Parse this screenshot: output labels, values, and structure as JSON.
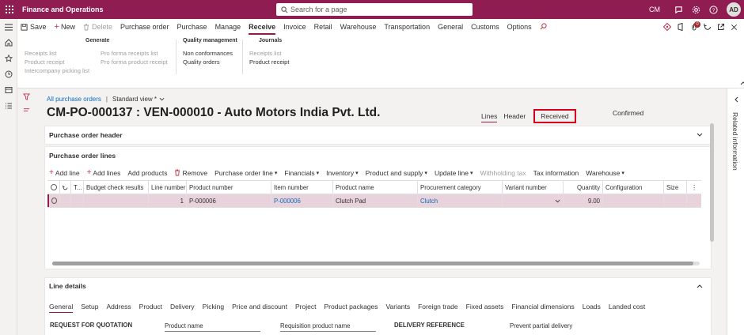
{
  "top_bar": {
    "app_title": "Finance and Operations",
    "search_placeholder": "Search for a page",
    "company": "CM",
    "avatar_initials": "AD",
    "brand_color": "#8f1d52"
  },
  "action_pane": {
    "commands": {
      "save": "Save",
      "new": "New",
      "delete": "Delete"
    },
    "tabs": [
      "Purchase order",
      "Purchase",
      "Manage",
      "Receive",
      "Invoice",
      "Retail",
      "Warehouse",
      "Transportation",
      "General",
      "Customs",
      "Options"
    ],
    "active_tab": "Receive",
    "notification_count": "0",
    "groups": {
      "generate": {
        "title": "Generate",
        "col1": [
          "Receipts list",
          "Product receipt",
          "Intercompany picking list"
        ],
        "col2": [
          "Pro forma receipts list",
          "Pro forma product receipt"
        ]
      },
      "quality": {
        "title": "Quality management",
        "items": [
          "Non conformances",
          "Quality orders"
        ]
      },
      "journals": {
        "title": "Journals",
        "items": [
          "Receipts list",
          "Product receipt"
        ]
      }
    }
  },
  "breadcrumb": {
    "link": "All purchase orders",
    "view": "Standard view *"
  },
  "page_title": "CM-PO-000137 : VEN-000010 - Auto Motors India Pvt. Ltd.",
  "view_tabs": {
    "lines": "Lines",
    "header": "Header",
    "received": "Received"
  },
  "status": "Confirmed",
  "sections": {
    "po_header": "Purchase order header",
    "po_lines": "Purchase order lines",
    "line_details": "Line details"
  },
  "lines_toolbar": {
    "add_line": "Add line",
    "add_lines": "Add lines",
    "add_products": "Add products",
    "remove": "Remove",
    "purchase_order_line": "Purchase order line",
    "financials": "Financials",
    "inventory": "Inventory",
    "product_and_supply": "Product and supply",
    "update_line": "Update line",
    "withholding_tax": "Withholding tax",
    "tax_information": "Tax information",
    "warehouse": "Warehouse"
  },
  "grid": {
    "columns": {
      "t": "T...",
      "budget": "Budget check results",
      "line_number": "Line number",
      "product_number": "Product number",
      "item_number": "Item number",
      "product_name": "Product name",
      "procurement_category": "Procurement category",
      "variant_number": "Variant number",
      "quantity": "Quantity",
      "configuration": "Configuration",
      "size": "Size"
    },
    "rows": [
      {
        "line_number": "1",
        "product_number": "P-000006",
        "item_number": "P-000006",
        "product_name": "Clutch Pad",
        "procurement_category": "Clutch",
        "quantity": "9.00"
      }
    ]
  },
  "detail_tabs": [
    "General",
    "Setup",
    "Address",
    "Product",
    "Delivery",
    "Picking",
    "Price and discount",
    "Project",
    "Product packages",
    "Variants",
    "Foreign trade",
    "Fixed assets",
    "Financial dimensions",
    "Loads",
    "Landed cost"
  ],
  "detail_form": {
    "rfq_title": "REQUEST FOR QUOTATION",
    "product_name_label": "Product name",
    "requisition_product_name_label": "Requisition product name",
    "delivery_reference_title": "DELIVERY REFERENCE",
    "prevent_partial_delivery_label": "Prevent partial delivery"
  },
  "related_information": "Related information"
}
